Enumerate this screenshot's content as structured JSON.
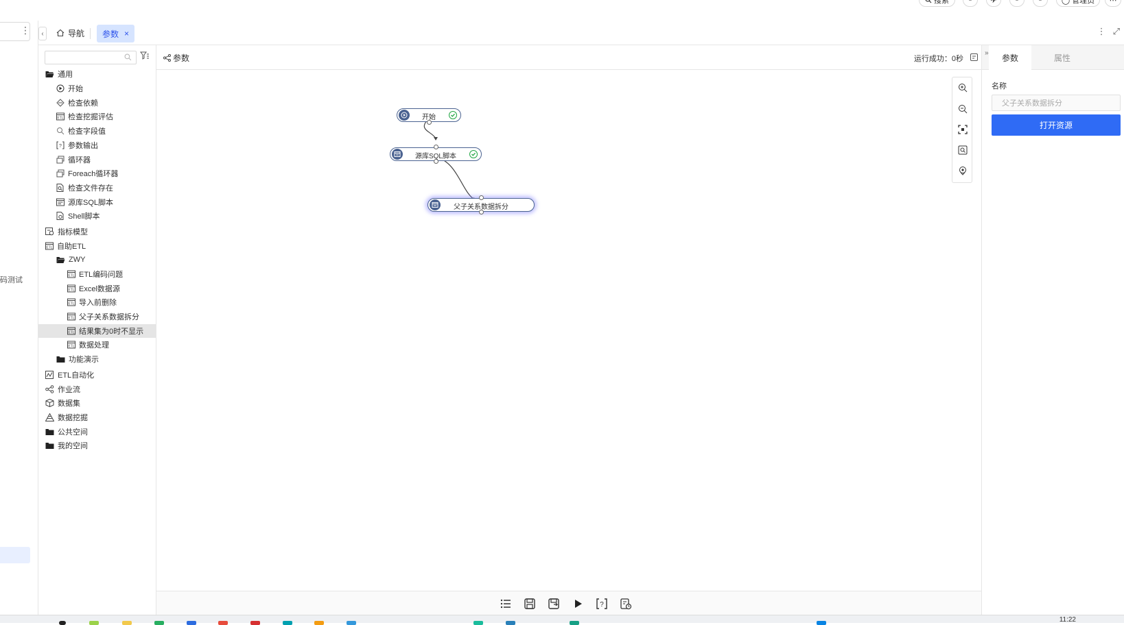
{
  "topbar": {
    "search_label": "搜索",
    "user_label": "管理员"
  },
  "rail": {
    "partial_text": "码测试"
  },
  "tabs": {
    "nav_label": "导航",
    "active_label": "参数",
    "close_glyph": "×",
    "more_glyph": "⋮",
    "expand_glyph": "⤢"
  },
  "tree": {
    "search_placeholder": "",
    "items": [
      {
        "label": "通用",
        "icon": "folder-open-icon"
      },
      {
        "label": "开始",
        "icon": "play-circle-icon"
      },
      {
        "label": "检查依赖",
        "icon": "dependency-icon"
      },
      {
        "label": "检查挖掘评估",
        "icon": "etl-icon"
      },
      {
        "label": "检查字段值",
        "icon": "field-check-icon"
      },
      {
        "label": "参数输出",
        "icon": "param-output-icon"
      },
      {
        "label": "循环器",
        "icon": "loop-icon"
      },
      {
        "label": "Foreach循环器",
        "icon": "loop-icon"
      },
      {
        "label": "检查文件存在",
        "icon": "file-search-icon"
      },
      {
        "label": "源库SQL脚本",
        "icon": "sql-icon"
      },
      {
        "label": "Shell脚本",
        "icon": "shell-icon"
      },
      {
        "label": "指标模型",
        "icon": "indicator-icon"
      },
      {
        "label": "自助ETL",
        "icon": "etl-icon"
      },
      {
        "label": "ZWY",
        "icon": "folder-open-icon"
      },
      {
        "label": "ETL编码问题",
        "icon": "etl-icon"
      },
      {
        "label": "Excel数据源",
        "icon": "etl-icon"
      },
      {
        "label": "导入前删除",
        "icon": "etl-icon"
      },
      {
        "label": "父子关系数据拆分",
        "icon": "etl-icon"
      },
      {
        "label": "结果集为0时不显示",
        "icon": "etl-icon"
      },
      {
        "label": "数据处理",
        "icon": "etl-icon"
      },
      {
        "label": "功能演示",
        "icon": "folder-icon"
      },
      {
        "label": "ETL自动化",
        "icon": "etl-auto-icon"
      },
      {
        "label": "作业流",
        "icon": "workflow-icon"
      },
      {
        "label": "数据集",
        "icon": "dataset-icon"
      },
      {
        "label": "数据挖掘",
        "icon": "mining-icon"
      },
      {
        "label": "公共空间",
        "icon": "folder-icon"
      },
      {
        "label": "我的空间",
        "icon": "folder-icon"
      }
    ]
  },
  "canvas": {
    "title": "参数",
    "run_status": "运行成功：0秒",
    "nodes": [
      {
        "label": "开始",
        "status": "success"
      },
      {
        "label": "源库SQL脚本",
        "status": "success"
      },
      {
        "label": "父子关系数据拆分",
        "status": "selected"
      }
    ]
  },
  "props": {
    "tab_params": "参数",
    "tab_attrs": "属性",
    "name_label": "名称",
    "name_value": "父子关系数据拆分",
    "open_button": "打开资源"
  },
  "taskbar": {
    "clock": "11:22"
  },
  "colors": {
    "accent": "#2f6bf5",
    "tab_active_bg": "#d6e4ff",
    "node_border": "#4a6290",
    "success": "#22a644"
  }
}
